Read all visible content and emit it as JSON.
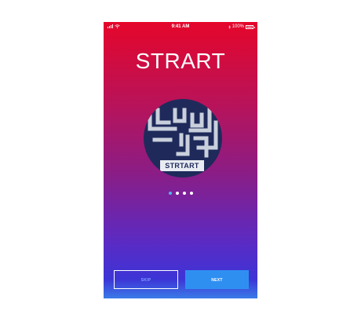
{
  "status_bar": {
    "time": "9:41 AM",
    "battery_text": "100%",
    "battery_level": 1.0,
    "icons": [
      "signal-icon",
      "wifi-icon",
      "bluetooth-icon",
      "battery-icon"
    ]
  },
  "onboarding": {
    "title": "STRART",
    "logo_text": "STRTART",
    "page_count": 4,
    "active_page": 1
  },
  "buttons": {
    "skip_label": "SKIP",
    "next_label": "NEXT"
  },
  "colors": {
    "gradient_top": "#e5062a",
    "gradient_bottom": "#3d34d6",
    "next_button": "#2f8ff0",
    "active_dot": "#4db3f5",
    "logo_background": "#1f2a5b"
  }
}
